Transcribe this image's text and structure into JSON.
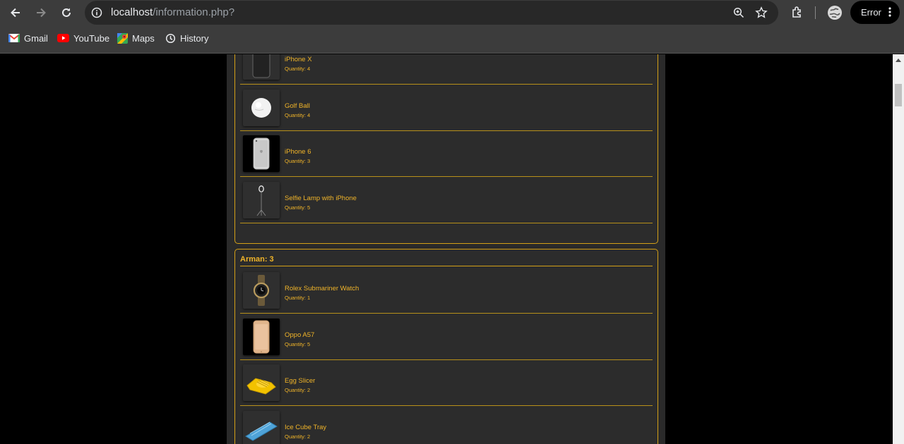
{
  "browser": {
    "url_host": "localhost",
    "url_path": "/information.php?",
    "profile_status": "Error",
    "bookmarks": [
      {
        "label": "Gmail",
        "icon": "gmail-icon"
      },
      {
        "label": "YouTube",
        "icon": "youtube-icon"
      },
      {
        "label": "Maps",
        "icon": "maps-icon"
      },
      {
        "label": "History",
        "icon": "history-icon"
      }
    ]
  },
  "colors": {
    "accent": "#f0b429",
    "border": "#d4a017",
    "panel": "#2c2c2c"
  },
  "panels": [
    {
      "title": "",
      "items": [
        {
          "name": "iPhone X",
          "qty_label": "Quantity:",
          "qty": "4",
          "icon": "iphone-x-image"
        },
        {
          "name": "Golf Ball",
          "qty_label": "Quantity:",
          "qty": "4",
          "icon": "golf-ball-image"
        },
        {
          "name": "iPhone 6",
          "qty_label": "Quantity:",
          "qty": "3",
          "icon": "iphone-6-image"
        },
        {
          "name": "Selfie Lamp with iPhone",
          "qty_label": "Quantity:",
          "qty": "5",
          "icon": "selfie-lamp-image"
        }
      ]
    },
    {
      "title": "Arman: 3",
      "items": [
        {
          "name": "Rolex Submariner Watch",
          "qty_label": "Quantity:",
          "qty": "1",
          "icon": "watch-image"
        },
        {
          "name": "Oppo A57",
          "qty_label": "Quantity:",
          "qty": "5",
          "icon": "oppo-phone-image"
        },
        {
          "name": "Egg Slicer",
          "qty_label": "Quantity:",
          "qty": "2",
          "icon": "egg-slicer-image"
        },
        {
          "name": "Ice Cube Tray",
          "qty_label": "Quantity:",
          "qty": "2",
          "icon": "ice-tray-image"
        }
      ]
    }
  ]
}
